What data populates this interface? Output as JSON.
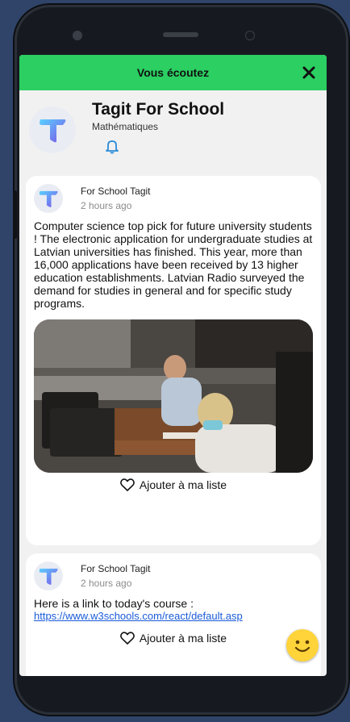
{
  "topbar": {
    "title": "Vous écoutez",
    "close_icon": "close-icon"
  },
  "channel": {
    "title": "Tagit For School",
    "subtitle": "Mathématiques",
    "bell_icon": "bell-icon"
  },
  "posts": [
    {
      "author": "For School Tagit",
      "time": "2 hours ago",
      "text": "Computer science top pick for future university students ! The electronic application for undergraduate studies at Latvian universities has finished. This year, more than 16,000 applications have been received by 13 higher education establishments. Latvian Radio surveyed the demand for studies in general and for specific study programs.",
      "like_label": "Ajouter à ma liste"
    },
    {
      "author": "For School Tagit",
      "time": "2 hours ago",
      "text": "Here is a link to today's course :",
      "link": "https://www.w3schools.com/react/default.asp",
      "like_label": "Ajouter à ma liste"
    }
  ],
  "colors": {
    "accent": "#2bcf62",
    "link": "#1a5bd8",
    "background": "#2f4468"
  }
}
